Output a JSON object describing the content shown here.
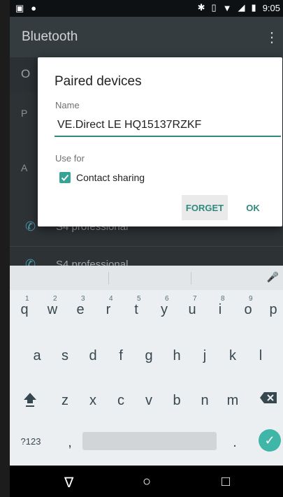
{
  "status_bar": {
    "time": "9:05"
  },
  "app_bar": {
    "title": "Bluetooth",
    "menu_icon": "overflow-menu-icon"
  },
  "background_list": {
    "toggle_label": "O",
    "paired_header": "P",
    "available_header": "A",
    "devices": [
      "S4 professional",
      "S4 professional"
    ]
  },
  "dialog": {
    "title": "Paired devices",
    "name_label": "Name",
    "name_value": "VE.Direct LE HQ15137RZKF",
    "use_for_label": "Use for",
    "contact_sharing_label": "Contact sharing",
    "contact_sharing_checked": true,
    "forget_button": "FORGET",
    "ok_button": "OK",
    "accent_color": "#2e8a7e"
  },
  "keyboard": {
    "row1": [
      "q",
      "w",
      "e",
      "r",
      "t",
      "y",
      "u",
      "i",
      "o",
      "p"
    ],
    "row1_hints": [
      "1",
      "2",
      "3",
      "4",
      "5",
      "6",
      "7",
      "8",
      "9"
    ],
    "row2": [
      "a",
      "s",
      "d",
      "f",
      "g",
      "h",
      "j",
      "k",
      "l"
    ],
    "row3": [
      "z",
      "x",
      "c",
      "v",
      "b",
      "n",
      "m"
    ],
    "symbols_key": "?123",
    "comma_key": ",",
    "period_key": "."
  },
  "nav_bar": {
    "back": "∇",
    "home": "○",
    "recents": "□"
  }
}
